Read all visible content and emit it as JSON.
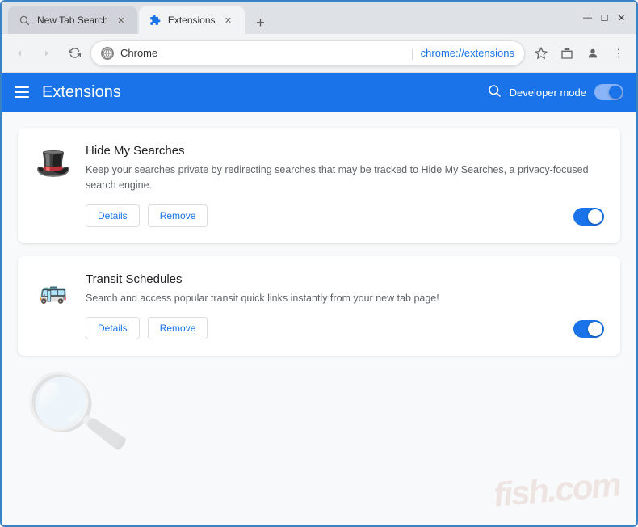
{
  "browser": {
    "tabs": [
      {
        "id": "tab-new-tab-search",
        "label": "New Tab Search",
        "icon": "🔍",
        "active": false
      },
      {
        "id": "tab-extensions",
        "label": "Extensions",
        "icon": "🧩",
        "active": true
      }
    ],
    "new_tab_button": "+",
    "window_controls": {
      "minimize": "—",
      "maximize": "☐",
      "close": "✕"
    }
  },
  "omnibox": {
    "back_title": "Back",
    "forward_title": "Forward",
    "reload_title": "Reload",
    "site_name": "Chrome",
    "separator": "|",
    "url": "chrome://extensions",
    "bookmark_title": "Bookmark",
    "more_title": "More"
  },
  "extensions_page": {
    "hamburger_label": "Menu",
    "title": "Extensions",
    "search_label": "Search",
    "developer_mode_label": "Developer mode",
    "developer_mode_on": true
  },
  "extensions": [
    {
      "id": "ext-hide-my-searches",
      "name": "Hide My Searches",
      "description": "Keep your searches private by redirecting searches that may be tracked to Hide My Searches, a privacy-focused search engine.",
      "icon": "🎩",
      "enabled": true,
      "details_label": "Details",
      "remove_label": "Remove"
    },
    {
      "id": "ext-transit-schedules",
      "name": "Transit Schedules",
      "description": "Search and access popular transit quick links instantly from your new tab page!",
      "icon": "🚌",
      "enabled": true,
      "details_label": "Details",
      "remove_label": "Remove"
    }
  ],
  "watermark": {
    "text": "fish.com"
  }
}
